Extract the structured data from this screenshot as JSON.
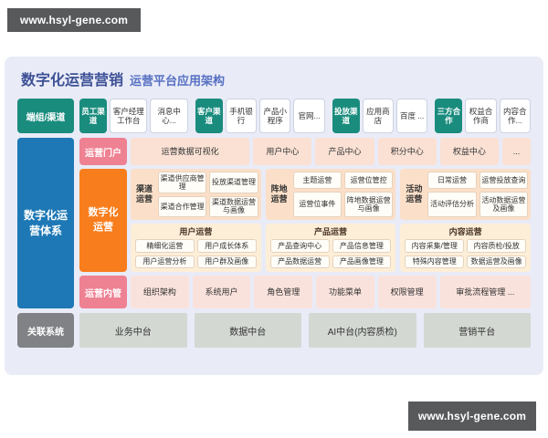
{
  "watermark": {
    "text": "www.hsyl-gene.com"
  },
  "title": {
    "main": "数字化运营营销",
    "sub": "运营平台应用架构"
  },
  "channels": {
    "label": "端组/渠道",
    "cells": [
      "员工渠道",
      "客户经理工作台",
      "消息中心...",
      "客户渠道",
      "手机银行",
      "产品小程序",
      "官网...",
      "投放渠道",
      "应用商店",
      "百度 ...",
      "三方合作",
      "权益合作商",
      "内容合作..."
    ]
  },
  "system_column": {
    "label": "数字化运营体系"
  },
  "portal": {
    "label": "运营门户",
    "items": [
      "运营数据可视化",
      "用户中心",
      "产品中心",
      "积分中心",
      "权益中心",
      "..."
    ]
  },
  "digital_ops": {
    "label": "数字化运营",
    "top_groups": [
      {
        "label": "渠道运营",
        "items": [
          "渠道供应商管理",
          "投放渠道管理",
          "渠道合作管理",
          "渠道数据运营与画像"
        ]
      },
      {
        "label": "阵地运营",
        "items": [
          "主题运营",
          "运营位管控",
          "运营位事件",
          "阵地数据运营与画像"
        ]
      },
      {
        "label": "活动运营",
        "items": [
          "日常运营",
          "运营投放查询",
          "活动评估分析",
          "活动数据运营及画像"
        ]
      }
    ],
    "bottom_groups": [
      {
        "title": "用户运营",
        "items": [
          "精细化运营",
          "用户成长体系",
          "用户运营分析",
          "用户群及画像"
        ]
      },
      {
        "title": "产品运营",
        "items": [
          "产品查询中心",
          "产品信息管理",
          "产品数据运营",
          "产品画像管理"
        ]
      },
      {
        "title": "内容运营",
        "items": [
          "内容采集/管理",
          "内容质检/投放",
          "特殊内容管理",
          "数据运营及画像"
        ]
      }
    ]
  },
  "internal": {
    "label": "运营内管",
    "items": [
      "组织架构",
      "系统用户",
      "角色管理",
      "功能菜单",
      "权限管理",
      "审批流程管理 ..."
    ]
  },
  "related": {
    "label": "关联系统",
    "items": [
      "业务中台",
      "数据中台",
      "AI中台(内容质检)",
      "营销平台"
    ]
  },
  "colors": {
    "teal": "#1a8c7e",
    "blue": "#1d78b5",
    "orange": "#f87d1c",
    "pink": "#ee8192",
    "peach_group": "#fbdfc8",
    "cream_group": "#fdeed8",
    "soft_pink_item": "#fae1d4",
    "gray_label": "#808285",
    "gray_box": "#d3d8d2",
    "card_bg": "#e9ebf7",
    "title_blue": "#3d5196",
    "watermark_bg": "#58595b"
  }
}
